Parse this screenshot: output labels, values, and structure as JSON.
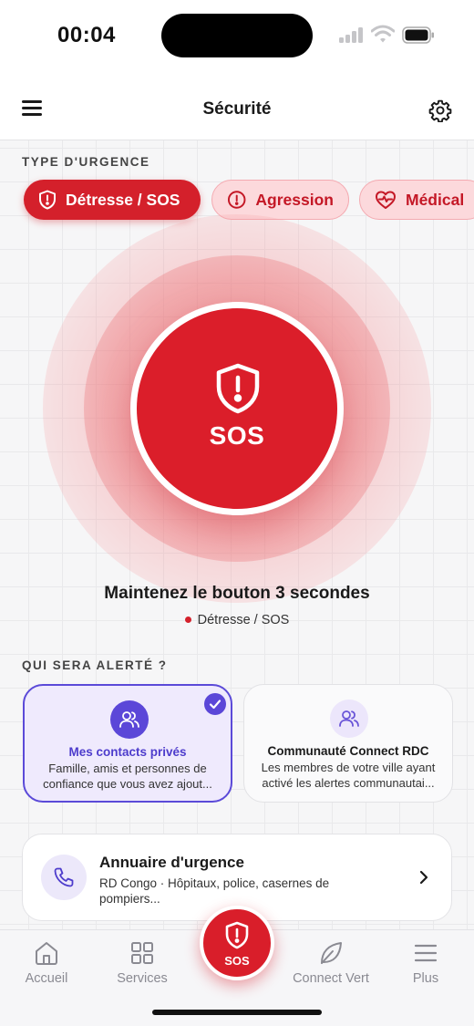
{
  "status_bar": {
    "time": "00:04"
  },
  "header": {
    "title": "Sécurité"
  },
  "emergency_type": {
    "section_label": "TYPE D'URGENCE",
    "chips": [
      {
        "label": "Détresse / SOS",
        "icon": "shield-alert-icon",
        "selected": true
      },
      {
        "label": "Agression",
        "icon": "alert-circle-icon",
        "selected": false
      },
      {
        "label": "Médical",
        "icon": "heart-pulse-icon",
        "selected": false
      }
    ]
  },
  "sos": {
    "button_label": "SOS",
    "instruction": "Maintenez le bouton 3 secondes",
    "selected_type": "Détresse / SOS"
  },
  "alerted": {
    "section_label": "QUI SERA ALERTÉ ?",
    "cards": [
      {
        "title": "Mes contacts privés",
        "description": "Famille, amis et personnes de confiance que vous avez ajout...",
        "selected": true
      },
      {
        "title": "Communauté Connect RDC",
        "description": "Les membres de votre ville ayant activé les alertes communautai...",
        "selected": false
      }
    ]
  },
  "directory": {
    "title": "Annuaire d'urgence",
    "description": "RD Congo · Hôpitaux, police, casernes de pompiers..."
  },
  "bottom_nav": {
    "items": [
      {
        "label": "Accueil",
        "icon": "home-icon"
      },
      {
        "label": "Services",
        "icon": "grid-icon"
      },
      {
        "label": "Connect Vert",
        "icon": "leaf-icon"
      },
      {
        "label": "Plus",
        "icon": "menu-icon"
      }
    ],
    "center_button": "SOS"
  },
  "colors": {
    "accent_red": "#d4202b",
    "accent_purple": "#5b47d8",
    "chip_inactive_bg": "#fcd9dc"
  }
}
